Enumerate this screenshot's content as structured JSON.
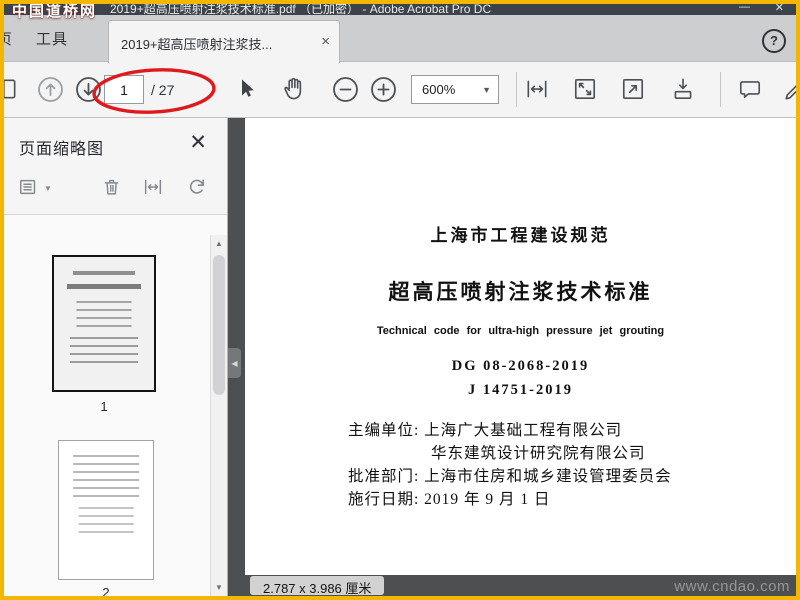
{
  "window": {
    "title": "2019+超高压喷射注浆技术标准.pdf （已加密） - Adobe Acrobat Pro DC",
    "watermark_top": "中国道桥网",
    "watermark_bottom": "www.cndao.com",
    "border_color": "#f3b700",
    "annotation_color": "#e0191c"
  },
  "tab_bar": {
    "home_tab": "主页",
    "tools_tab": "工具",
    "document_tab": "2019+超高压喷射注浆技..."
  },
  "toolbar": {
    "page_value": "1",
    "page_total": "/ 27",
    "zoom_value": "600%"
  },
  "thumbnails_panel": {
    "title": "页面缩略图",
    "items": [
      {
        "label": "1",
        "selected": true
      },
      {
        "label": "2",
        "selected": false
      }
    ]
  },
  "document": {
    "series_title": "上海市工程建设规范",
    "main_title": "超高压喷射注浆技术标准",
    "english_title": "Technical code for ultra-high pressure jet grouting",
    "standard_no_1": "DG 08-2068-2019",
    "standard_no_2": "J 14751-2019",
    "chief_editor_line": "主编单位: 上海广大基础工程有限公司",
    "co_editor_line": "华东建筑设计研究院有限公司",
    "approval_line": "批准部门: 上海市住房和城乡建设管理委员会",
    "effective_line": "施行日期: 2019 年 9 月 1 日"
  },
  "status_bar": {
    "page_size": "2.787 x 3.986 厘米"
  },
  "icons": {
    "window_minimize": "—",
    "window_close": "✕",
    "tab_close": "×",
    "help": "?",
    "dropdown_caret": "▼",
    "options_caret": "▼",
    "panel_close": "✕",
    "collapse_left": "◀",
    "scroll_up": "▲",
    "scroll_down": "▼"
  }
}
